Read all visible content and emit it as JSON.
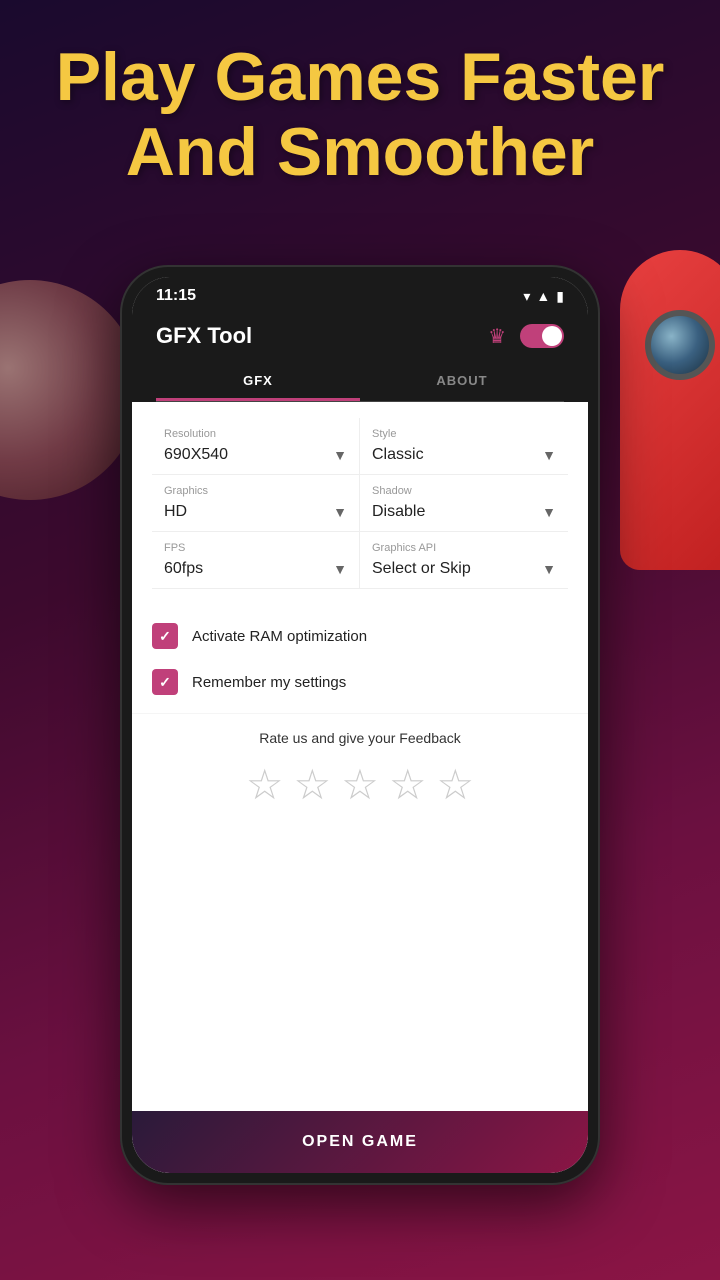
{
  "hero": {
    "title": "Play Games Faster And Smoother"
  },
  "status_bar": {
    "time": "11:15",
    "wifi_icon": "▾",
    "signal_icon": "▲",
    "battery_icon": "▮"
  },
  "app": {
    "title": "GFX Tool",
    "crown_icon": "♛",
    "tabs": [
      {
        "label": "GFX",
        "active": true
      },
      {
        "label": "ABOUT",
        "active": false
      }
    ]
  },
  "settings": {
    "resolution": {
      "label": "Resolution",
      "value": "690X540"
    },
    "style": {
      "label": "Style",
      "value": "Classic"
    },
    "graphics": {
      "label": "Graphics",
      "value": "HD"
    },
    "shadow": {
      "label": "Shadow",
      "value": "Disable"
    },
    "fps": {
      "label": "FPS",
      "value": "60fps"
    },
    "graphics_api": {
      "label": "Graphics API",
      "value": "Select or Skip"
    }
  },
  "checkboxes": [
    {
      "label": "Activate RAM optimization",
      "checked": true
    },
    {
      "label": "Remember my settings",
      "checked": true
    }
  ],
  "rating": {
    "text": "Rate us and give your Feedback",
    "stars": [
      "★",
      "★",
      "★",
      "★",
      "★"
    ]
  },
  "open_game_button": {
    "label": "OPEN GAME"
  },
  "colors": {
    "accent": "#c0407a",
    "hero_text": "#f5c842",
    "background_start": "#1a0a2e",
    "background_end": "#8b1545"
  }
}
